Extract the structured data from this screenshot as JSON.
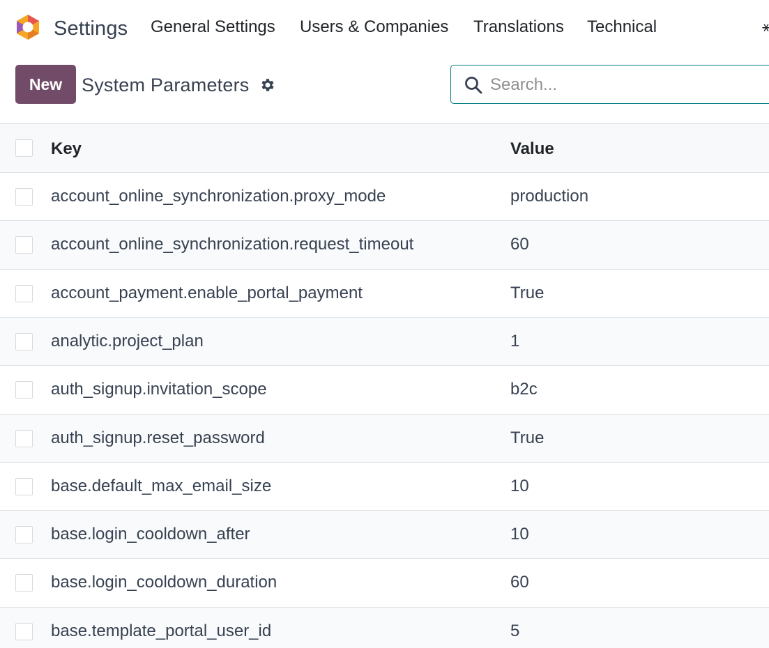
{
  "app": {
    "name": "Settings"
  },
  "menu": [
    {
      "label": "General Settings"
    },
    {
      "label": "Users & Companies"
    },
    {
      "label": "Translations"
    },
    {
      "label": "Technical"
    }
  ],
  "menu_more": "⚹",
  "control_panel": {
    "new_label": "New",
    "title": "System Parameters",
    "search_placeholder": "Search..."
  },
  "table": {
    "columns": {
      "key": "Key",
      "value": "Value"
    },
    "rows": [
      {
        "key": "account_online_synchronization.proxy_mode",
        "value": "production"
      },
      {
        "key": "account_online_synchronization.request_timeout",
        "value": "60"
      },
      {
        "key": "account_payment.enable_portal_payment",
        "value": "True"
      },
      {
        "key": "analytic.project_plan",
        "value": "1"
      },
      {
        "key": "auth_signup.invitation_scope",
        "value": "b2c"
      },
      {
        "key": "auth_signup.reset_password",
        "value": "True"
      },
      {
        "key": "base.default_max_email_size",
        "value": "10"
      },
      {
        "key": "base.login_cooldown_after",
        "value": "10"
      },
      {
        "key": "base.login_cooldown_duration",
        "value": "60"
      },
      {
        "key": "base.template_portal_user_id",
        "value": "5"
      }
    ]
  },
  "colors": {
    "brand": "#714b67",
    "accent": "#017e84",
    "logo_orange": "#f5a623",
    "logo_purple": "#9b59b6"
  },
  "icons": {
    "logo": "odoo-settings-logo-icon",
    "gear": "gear-icon",
    "search": "search-icon"
  }
}
